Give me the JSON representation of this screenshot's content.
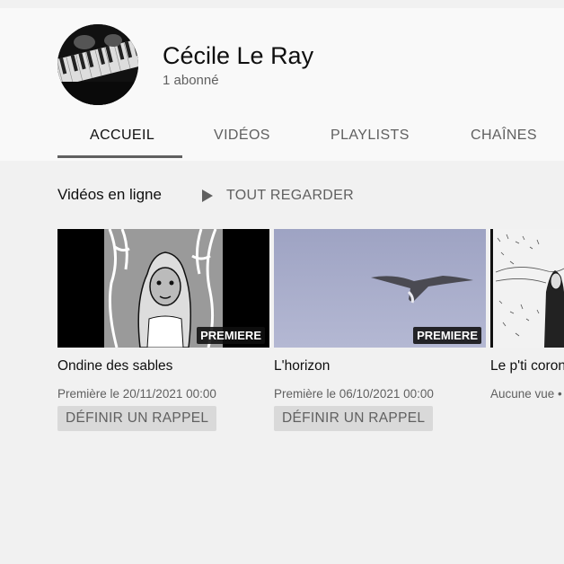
{
  "channel": {
    "name": "Cécile Le Ray",
    "subscribers": "1 abonné"
  },
  "tabs": [
    {
      "label": "ACCUEIL",
      "active": true
    },
    {
      "label": "VIDÉOS",
      "active": false
    },
    {
      "label": "PLAYLISTS",
      "active": false
    },
    {
      "label": "CHAÎNES",
      "active": false
    }
  ],
  "section": {
    "title": "Vidéos en ligne",
    "play_all_label": "TOUT REGARDER"
  },
  "videos": [
    {
      "title": "Ondine des sables",
      "meta": "Première le 20/11/2021 00:00",
      "badge": "PREMIERE",
      "action": "DÉFINIR UN RAPPEL"
    },
    {
      "title": "L'horizon",
      "meta": "Première le 06/10/2021 00:00",
      "badge": "PREMIERE",
      "action": "DÉFINIR UN RAPPEL"
    },
    {
      "title": "Le p'ti coron",
      "meta": "Aucune vue •"
    }
  ],
  "icons": {
    "play": "play-icon",
    "avatar": "piano-avatar"
  },
  "colors": {
    "header_bg": "#f9f9f9",
    "page_bg": "#f1f1f1",
    "text_primary": "#0f0f0f",
    "text_secondary": "#606060"
  }
}
